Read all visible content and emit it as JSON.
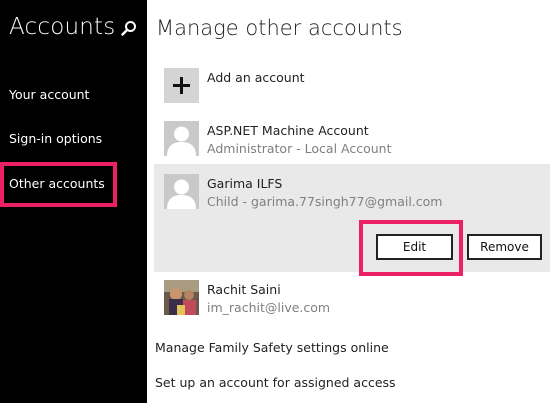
{
  "sidebar": {
    "title": "Accounts",
    "search_icon": "search-icon",
    "items": [
      {
        "label": "Your account"
      },
      {
        "label": "Sign-in options"
      },
      {
        "label": "Other accounts",
        "highlighted": true
      }
    ]
  },
  "main": {
    "title": "Manage other accounts",
    "add_account": {
      "label": "Add an account",
      "icon": "plus-icon"
    },
    "accounts": [
      {
        "name": "ASP.NET Machine Account",
        "detail": "Administrator - Local Account",
        "avatar": "default-user-avatar"
      },
      {
        "name": "Garima ILFS",
        "detail": "Child - garima.77singh77@gmail.com",
        "avatar": "default-user-avatar",
        "selected": true
      },
      {
        "name": "Rachit Saini",
        "detail": "im_rachit@live.com",
        "avatar": "photo-avatar"
      }
    ],
    "actions": {
      "edit": "Edit",
      "remove": "Remove"
    },
    "links": {
      "family_safety": "Manage Family Safety settings online",
      "assigned_access": "Set up an account for assigned access"
    }
  },
  "colors": {
    "sidebar_bg": "#000000",
    "highlight": "#ec2163",
    "selected_row_bg": "#e9e9e9",
    "tile_bg": "#d4d4d4"
  }
}
